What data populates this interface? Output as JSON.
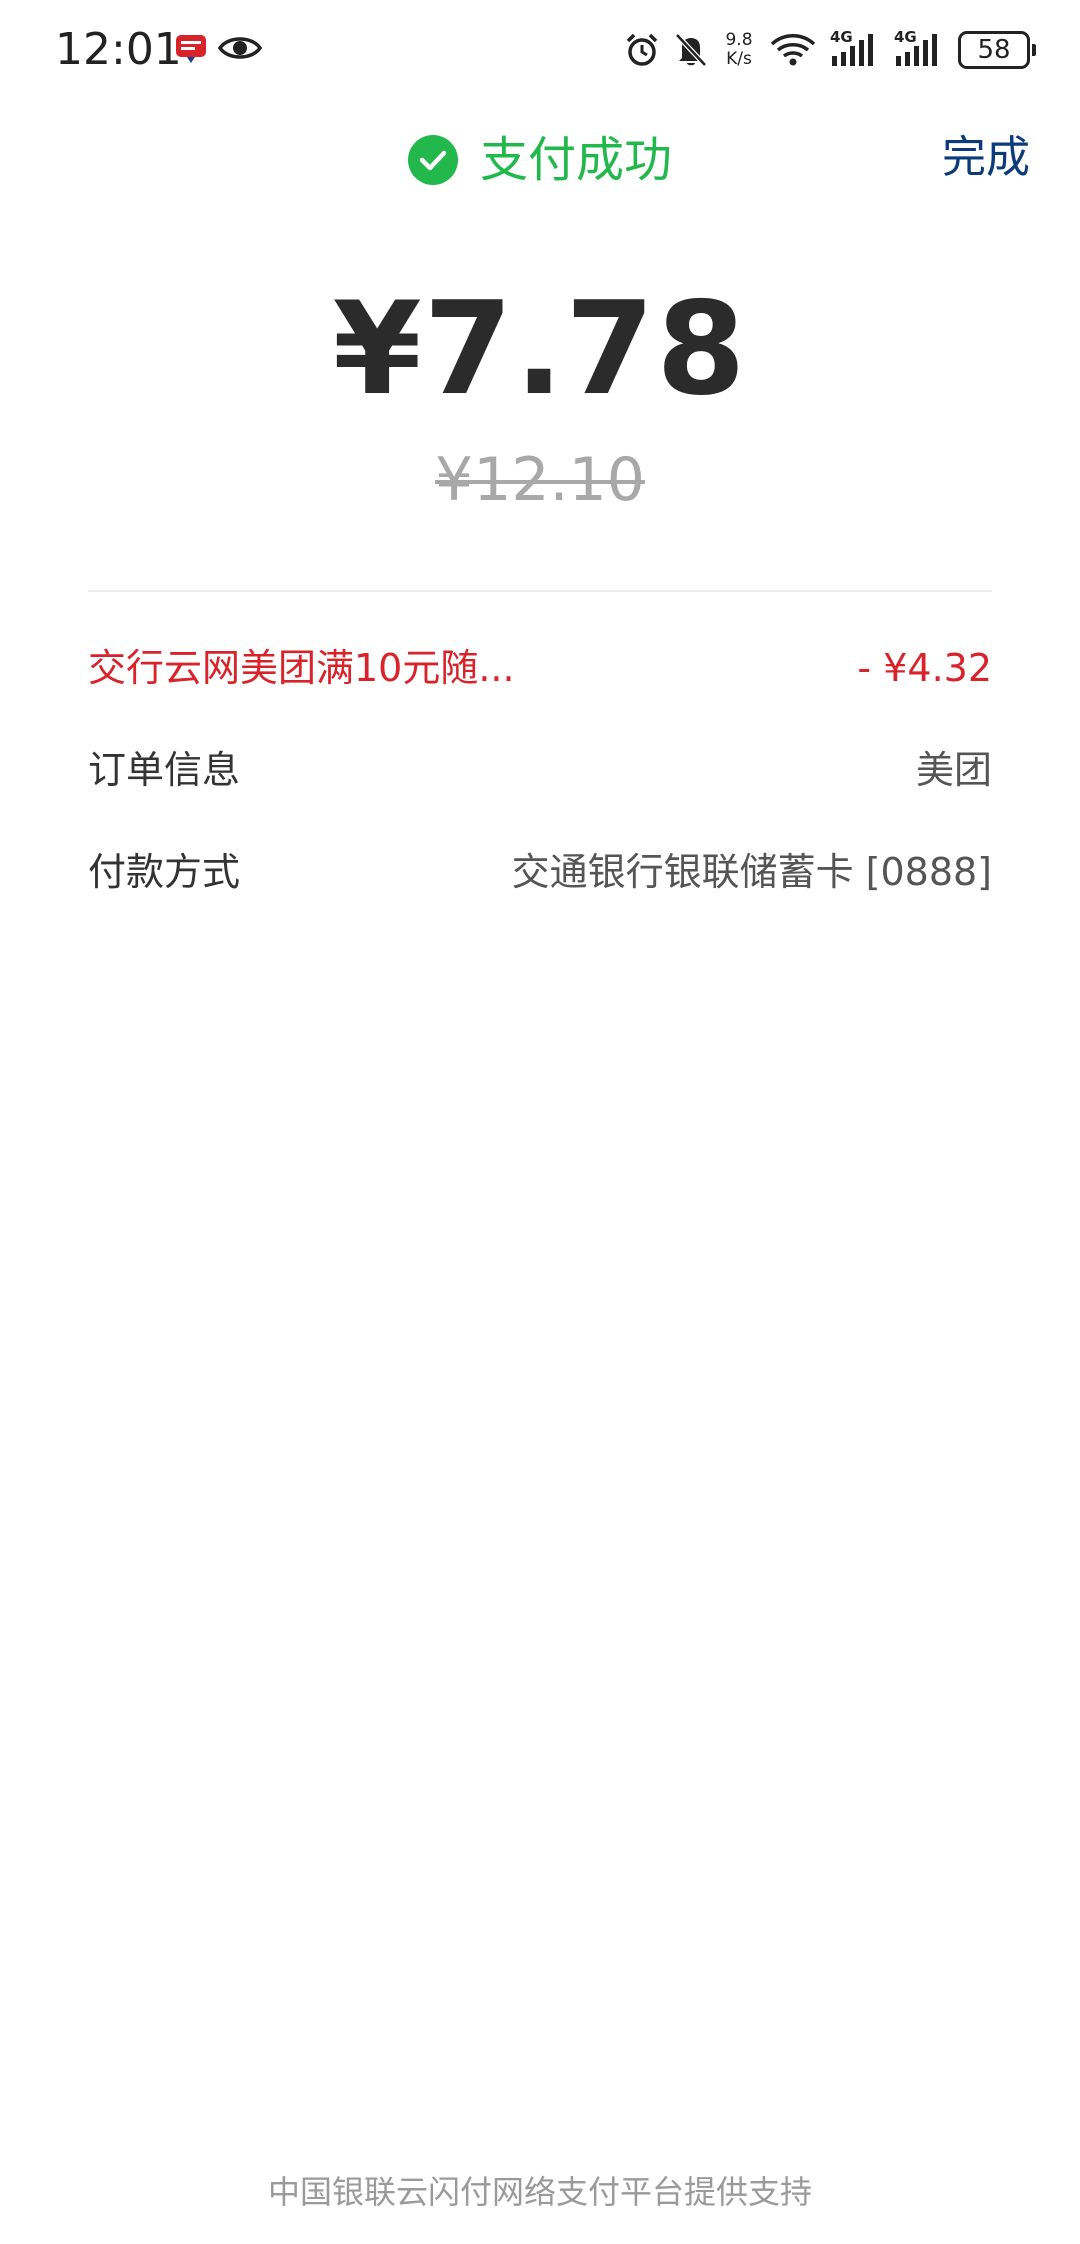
{
  "status_bar": {
    "time": "12:01",
    "network_speed_value": "9.8",
    "network_speed_unit": "K/s",
    "signal_1_label": "4G",
    "signal_2_label": "4G",
    "battery": "58",
    "icons": [
      "app-notification-icon",
      "eye-icon",
      "alarm-icon",
      "bell-muted-icon",
      "wifi-icon",
      "signal-icon",
      "signal-icon",
      "battery-icon"
    ]
  },
  "header": {
    "title": "支付成功",
    "done_label": "完成",
    "status_color": "#22b84c",
    "done_color": "#0b3b7a"
  },
  "payment": {
    "amount": "¥7.78",
    "original_amount": "¥12.10"
  },
  "details": [
    {
      "label": "交行云网美团满10元随...",
      "value": "- ¥4.32",
      "color": "#d8232a"
    },
    {
      "label": "订单信息",
      "value": "美团"
    },
    {
      "label": "付款方式",
      "value": "交通银行银联储蓄卡 [0888]"
    }
  ],
  "footer": {
    "text": "中国银联云闪付网络支付平台提供支持"
  }
}
